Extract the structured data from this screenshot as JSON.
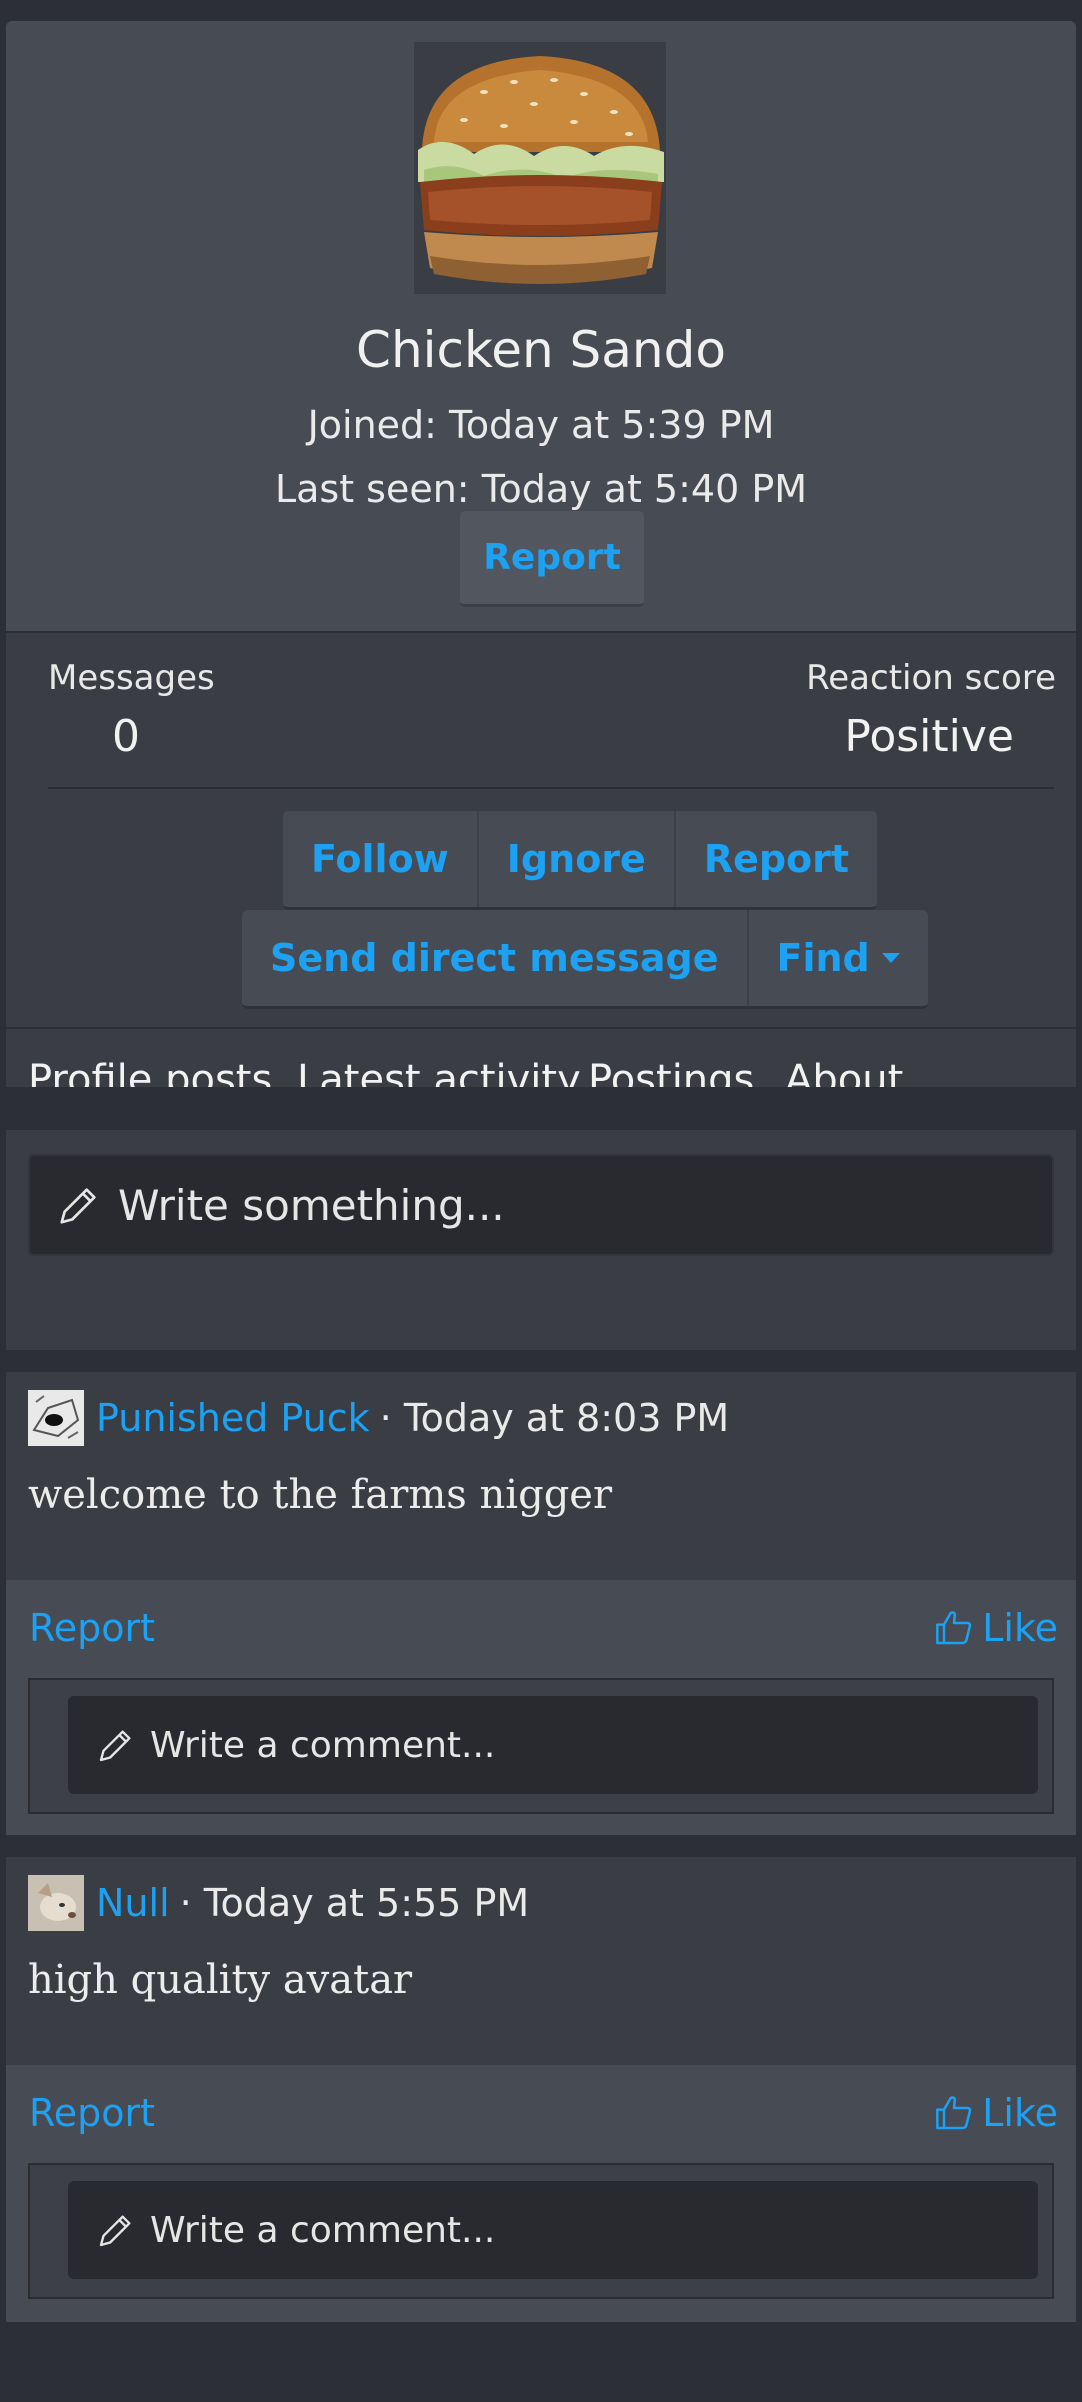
{
  "profile": {
    "name": "Chicken Sando",
    "joined": "Joined: Today at 5:39 PM",
    "last_seen": "Last seen: Today at 5:40 PM",
    "report_label": "Report"
  },
  "stats": {
    "messages_label": "Messages",
    "messages_value": "0",
    "reaction_label": "Reaction score",
    "reaction_value": "Positive"
  },
  "actions": {
    "follow": "Follow",
    "ignore": "Ignore",
    "report": "Report",
    "send_dm": "Send direct message",
    "find": "Find"
  },
  "tabs": [
    {
      "label": "Profile posts"
    },
    {
      "label": "Latest activity"
    },
    {
      "label": "Postings"
    },
    {
      "label": "About"
    }
  ],
  "write": {
    "placeholder": "Write something..."
  },
  "posts": [
    {
      "author": "Punished Puck",
      "time": "· Today at 8:03 PM",
      "body": "welcome to the farms nigger",
      "report": "Report",
      "like": "Like",
      "comment_placeholder": "Write a comment..."
    },
    {
      "author": "Null",
      "time": "· Today at 5:55 PM",
      "body": "high quality avatar",
      "report": "Report",
      "like": "Like",
      "comment_placeholder": "Write a comment..."
    }
  ],
  "colors": {
    "accent": "#1da1f2",
    "page_bg": "#2c2f35",
    "panel": "#3a3d44",
    "panel_light": "#474b53",
    "input_bg": "#282a2f"
  }
}
